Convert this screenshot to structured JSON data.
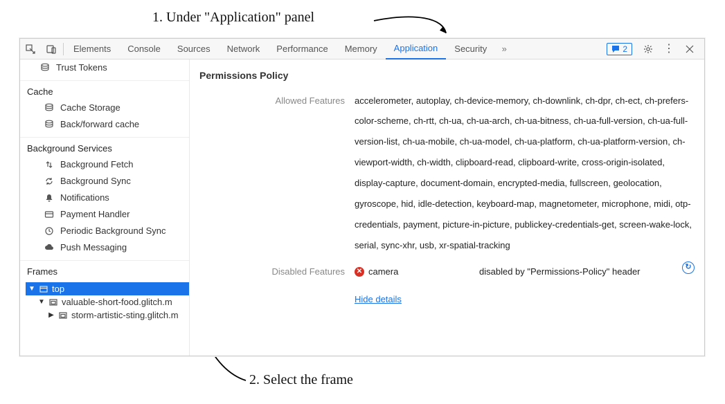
{
  "annotations": {
    "line1": "1. Under \"Application\" panel",
    "line2": "2. Select the frame"
  },
  "tabs": {
    "elements": "Elements",
    "console": "Console",
    "sources": "Sources",
    "network": "Network",
    "performance": "Performance",
    "memory": "Memory",
    "application": "Application",
    "security": "Security",
    "messages_count": "2"
  },
  "sidebar": {
    "trust_tokens": "Trust Tokens",
    "cache_title": "Cache",
    "cache_storage": "Cache Storage",
    "back_forward_cache": "Back/forward cache",
    "bg_title": "Background Services",
    "bg_fetch": "Background Fetch",
    "bg_sync": "Background Sync",
    "notifications": "Notifications",
    "payment": "Payment Handler",
    "periodic": "Periodic Background Sync",
    "push": "Push Messaging",
    "frames_title": "Frames",
    "top": "top",
    "frame1": "valuable-short-food.glitch.m",
    "frame2": "storm-artistic-sting.glitch.m"
  },
  "main": {
    "title": "Permissions Policy",
    "allowed_label": "Allowed Features",
    "allowed_value": "accelerometer, autoplay, ch-device-memory, ch-downlink, ch-dpr, ch-ect, ch-prefers-color-scheme, ch-rtt, ch-ua, ch-ua-arch, ch-ua-bitness, ch-ua-full-version, ch-ua-full-version-list, ch-ua-mobile, ch-ua-model, ch-ua-platform, ch-ua-platform-version, ch-viewport-width, ch-width, clipboard-read, clipboard-write, cross-origin-isolated, display-capture, document-domain, encrypted-media, fullscreen, geolocation, gyroscope, hid, idle-detection, keyboard-map, magnetometer, microphone, midi, otp-credentials, payment, picture-in-picture, publickey-credentials-get, screen-wake-lock, serial, sync-xhr, usb, xr-spatial-tracking",
    "disabled_label": "Disabled Features",
    "disabled_feature": "camera",
    "disabled_reason": "disabled by \"Permissions-Policy\" header",
    "hide_details": "Hide details"
  }
}
